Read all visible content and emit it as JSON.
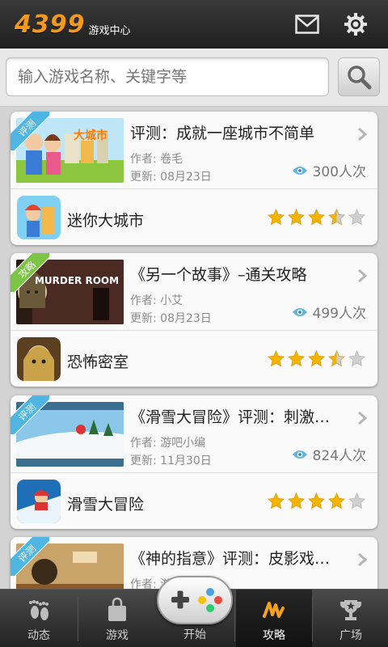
{
  "header": {
    "logo": "4399",
    "logo_sub": "游戏中心",
    "mail_icon": "mail-icon",
    "settings_icon": "gear-icon"
  },
  "search": {
    "placeholder": "输入游戏名称、关键字等",
    "button_icon": "search-icon"
  },
  "cards": [
    {
      "ribbon": "评测",
      "ribbon_color": "#4fb6e3",
      "title": "评测：成就一座城市不简单",
      "author": "作者: 卷毛",
      "updated": "更新: 08月23日",
      "views": "300人次",
      "app_name": "迷你大城市",
      "rating": 3.5,
      "thumb_text": "大城市"
    },
    {
      "ribbon": "攻略",
      "ribbon_color": "#7cc443",
      "title": "《另一个故事》–通关攻略",
      "author": "作者: 小艾",
      "updated": "更新: 08月23日",
      "views": "499人次",
      "app_name": "恐怖密室",
      "rating": 3.5,
      "thumb_text": "MURDER ROOM"
    },
    {
      "ribbon": "评测",
      "ribbon_color": "#4fb6e3",
      "title": "《滑雪大冒险》评测：刺激…",
      "author": "作者: 游吧小编",
      "updated": "更新: 11月30日",
      "views": "824人次",
      "app_name": "滑雪大冒险",
      "rating": 4,
      "thumb_text": ""
    },
    {
      "ribbon": "评测",
      "ribbon_color": "#4fb6e3",
      "title": "《神的指意》评测：皮影戏…",
      "author": "作者: 游吧小编",
      "updated": "",
      "views": "",
      "app_name": "",
      "rating": 0,
      "thumb_text": ""
    }
  ],
  "nav": {
    "items": [
      {
        "label": "动态",
        "icon": "footprints-icon"
      },
      {
        "label": "游戏",
        "icon": "shopping-bag-icon"
      },
      {
        "label": "开始",
        "icon": "gamepad-icon"
      },
      {
        "label": "攻略",
        "icon": "strategy-icon"
      },
      {
        "label": "广场",
        "icon": "trophy-icon"
      }
    ],
    "active": "攻略"
  },
  "colors": {
    "accent": "#f39a1d",
    "star": "#f5b400",
    "ribbon_blue": "#4fb6e3",
    "ribbon_green": "#7cc443"
  }
}
